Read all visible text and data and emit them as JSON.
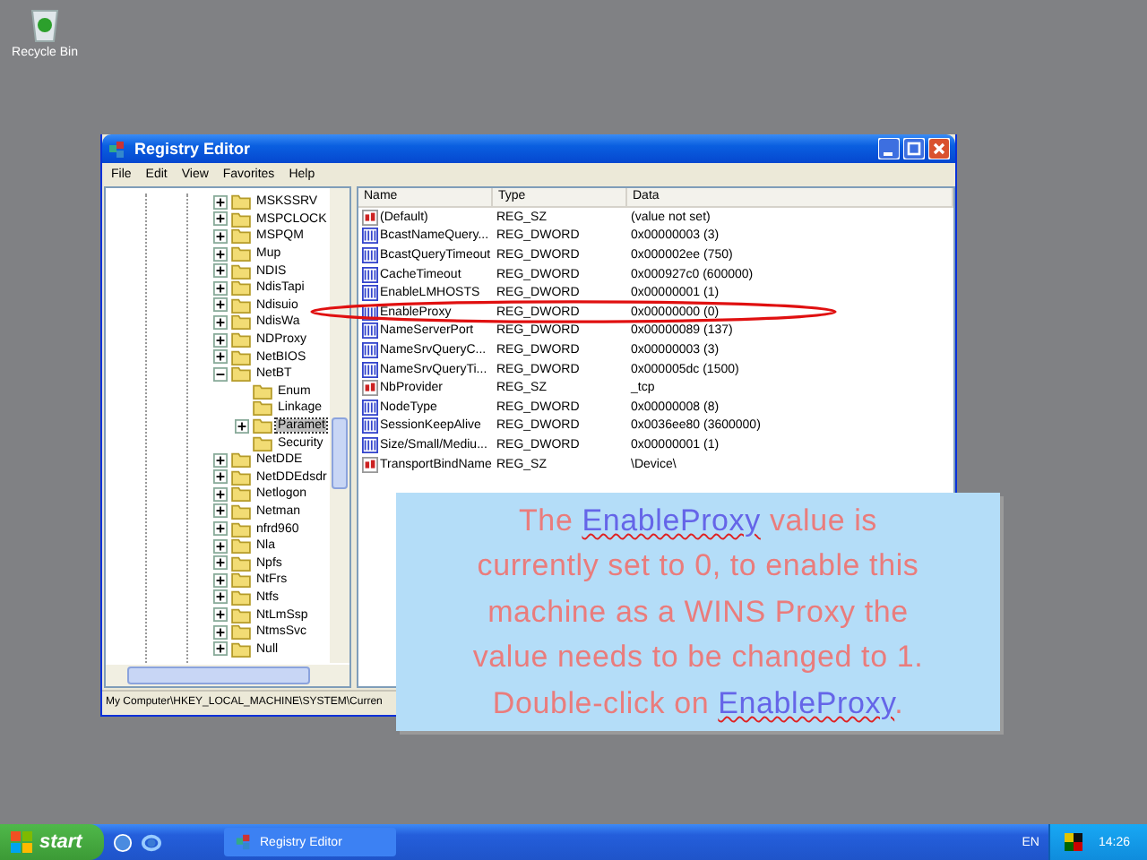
{
  "desktop_icons": [
    {
      "label": "Recycle Bin"
    }
  ],
  "window": {
    "title": "Registry Editor",
    "menu": [
      "File",
      "Edit",
      "View",
      "Favorites",
      "Help"
    ],
    "tree": [
      {
        "label": "MSKSSRV",
        "expandable": true,
        "expanded": false,
        "selected": false
      },
      {
        "label": "MSPCLOCK",
        "expandable": true,
        "expanded": false,
        "selected": false
      },
      {
        "label": "MSPQM",
        "expandable": true,
        "expanded": false,
        "selected": false
      },
      {
        "label": "Mup",
        "expandable": true,
        "expanded": false,
        "selected": false
      },
      {
        "label": "NDIS",
        "expandable": true,
        "expanded": false,
        "selected": false
      },
      {
        "label": "NdisTapi",
        "expandable": true,
        "expanded": false,
        "selected": false
      },
      {
        "label": "Ndisuio",
        "expandable": true,
        "expanded": false,
        "selected": false
      },
      {
        "label": "NdisWa",
        "expandable": true,
        "expanded": false,
        "selected": false
      },
      {
        "label": "NDProxy",
        "expandable": true,
        "expanded": false,
        "selected": false
      },
      {
        "label": "NetBIOS",
        "expandable": true,
        "expanded": false,
        "selected": false
      },
      {
        "label": "NetBT",
        "expandable": true,
        "expanded": true,
        "selected": false,
        "children": [
          {
            "label": "Enum",
            "expandable": false,
            "selected": false
          },
          {
            "label": "Linkage",
            "expandable": false,
            "selected": false
          },
          {
            "label": "Paramet",
            "expandable": true,
            "expanded": false,
            "selected": true
          },
          {
            "label": "Security",
            "expandable": false,
            "selected": false
          }
        ]
      },
      {
        "label": "NetDDE",
        "expandable": true,
        "expanded": false,
        "selected": false
      },
      {
        "label": "NetDDEdsdr",
        "expandable": true,
        "expanded": false,
        "selected": false
      },
      {
        "label": "Netlogon",
        "expandable": true,
        "expanded": false,
        "selected": false
      },
      {
        "label": "Netman",
        "expandable": true,
        "expanded": false,
        "selected": false
      },
      {
        "label": "nfrd960",
        "expandable": true,
        "expanded": false,
        "selected": false
      },
      {
        "label": "Nla",
        "expandable": true,
        "expanded": false,
        "selected": false
      },
      {
        "label": "Npfs",
        "expandable": true,
        "expanded": false,
        "selected": false
      },
      {
        "label": "NtFrs",
        "expandable": true,
        "expanded": false,
        "selected": false
      },
      {
        "label": "Ntfs",
        "expandable": true,
        "expanded": false,
        "selected": false
      },
      {
        "label": "NtLmSsp",
        "expandable": true,
        "expanded": false,
        "selected": false
      },
      {
        "label": "NtmsSvc",
        "expandable": true,
        "expanded": false,
        "selected": false
      },
      {
        "label": "Null",
        "expandable": true,
        "expanded": false,
        "selected": false
      }
    ],
    "columns": [
      "Name",
      "Type",
      "Data"
    ],
    "values": [
      {
        "kind": "string",
        "name": "(Default)",
        "type": "REG_SZ",
        "data": "(value not set)"
      },
      {
        "kind": "binary",
        "name": "BcastNameQuery...",
        "type": "REG_DWORD",
        "data": "0x00000003 (3)"
      },
      {
        "kind": "binary",
        "name": "BcastQueryTimeout",
        "type": "REG_DWORD",
        "data": "0x000002ee (750)"
      },
      {
        "kind": "binary",
        "name": "CacheTimeout",
        "type": "REG_DWORD",
        "data": "0x000927c0 (600000)"
      },
      {
        "kind": "binary",
        "name": "EnableLMHOSTS",
        "type": "REG_DWORD",
        "data": "0x00000001 (1)"
      },
      {
        "kind": "binary",
        "name": "EnableProxy",
        "type": "REG_DWORD",
        "data": "0x00000000 (0)"
      },
      {
        "kind": "binary",
        "name": "NameServerPort",
        "type": "REG_DWORD",
        "data": "0x00000089 (137)"
      },
      {
        "kind": "binary",
        "name": "NameSrvQueryC...",
        "type": "REG_DWORD",
        "data": "0x00000003 (3)"
      },
      {
        "kind": "binary",
        "name": "NameSrvQueryTi...",
        "type": "REG_DWORD",
        "data": "0x000005dc (1500)"
      },
      {
        "kind": "string",
        "name": "NbProvider",
        "type": "REG_SZ",
        "data": "_tcp"
      },
      {
        "kind": "binary",
        "name": "NodeType",
        "type": "REG_DWORD",
        "data": "0x00000008 (8)"
      },
      {
        "kind": "binary",
        "name": "SessionKeepAlive",
        "type": "REG_DWORD",
        "data": "0x0036ee80 (3600000)"
      },
      {
        "kind": "binary",
        "name": "Size/Small/Mediu...",
        "type": "REG_DWORD",
        "data": "0x00000001 (1)"
      },
      {
        "kind": "string",
        "name": "TransportBindName",
        "type": "REG_SZ",
        "data": "\\Device\\"
      }
    ],
    "status_bar": "My Computer\\HKEY_LOCAL_MACHINE\\SYSTEM\\Curren"
  },
  "callout": {
    "lines": [
      [
        {
          "text": "The ",
          "highlight": false
        },
        {
          "text": "EnableProxy",
          "highlight": true
        },
        {
          "text": " value is",
          "highlight": false
        }
      ],
      [
        {
          "text": "currently set to 0, to enable this",
          "highlight": false
        }
      ],
      [
        {
          "text": "machine as a WINS Proxy the",
          "highlight": false
        }
      ],
      [
        {
          "text": "value needs to be changed to 1.",
          "highlight": false
        }
      ],
      [
        {
          "text": "Double-click on ",
          "highlight": false
        },
        {
          "text": "EnableProxy",
          "highlight": true
        },
        {
          "text": ".",
          "highlight": false
        }
      ]
    ]
  },
  "taskbar": {
    "start": "start",
    "tasks": [
      {
        "label": "Registry Editor",
        "selected": false
      }
    ],
    "language": "EN",
    "clock": "14:26"
  }
}
